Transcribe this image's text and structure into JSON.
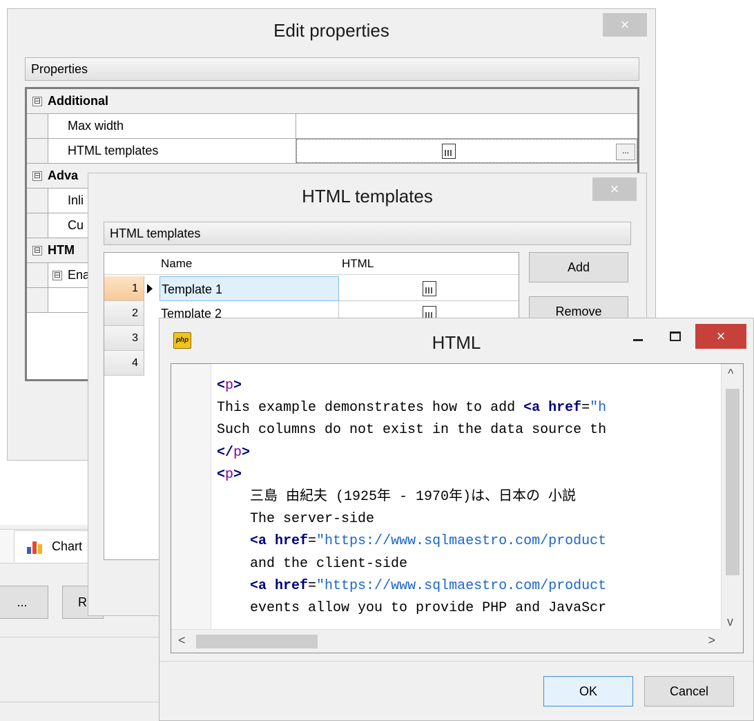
{
  "background": {
    "tab_label": "Chart",
    "button_left_label": "...",
    "button_right_label": "R"
  },
  "edit_dialog": {
    "title": "Edit properties",
    "close_glyph": "×",
    "group_label": "Properties",
    "categories": [
      {
        "label": "Additional",
        "expander": "⊟"
      },
      {
        "label": "Adva",
        "expander": "⊟"
      },
      {
        "label": "HTM",
        "expander": "⊟"
      }
    ],
    "properties": [
      {
        "name": "Max width",
        "value": ""
      },
      {
        "name": "HTML templates",
        "value": "",
        "ellipsis": "..."
      },
      {
        "name": "Inli"
      },
      {
        "name": "Cu"
      },
      {
        "name": "Ena",
        "expander": "⊟"
      }
    ]
  },
  "templates_dialog": {
    "title": "HTML templates",
    "close_glyph": "×",
    "group_label": "HTML templates",
    "columns": [
      "Name",
      "HTML"
    ],
    "rows": [
      {
        "num": "1",
        "name": "Template 1"
      },
      {
        "num": "2",
        "name": "Template 2"
      },
      {
        "num": "3",
        "name": ""
      },
      {
        "num": "4",
        "name": ""
      }
    ],
    "add_label": "Add",
    "remove_label": "Remove"
  },
  "html_window": {
    "icon_text": "php",
    "title": "HTML",
    "minimize_glyph": "–",
    "close_glyph": "×",
    "code_lines": [
      {
        "indent": "",
        "segments": [
          {
            "t": "<",
            "c": "tag"
          },
          {
            "t": "p",
            "c": "tname"
          },
          {
            "t": ">",
            "c": "tag"
          }
        ]
      },
      {
        "indent": "",
        "segments": [
          {
            "t": "This example demonstrates how to add ",
            "c": ""
          },
          {
            "t": "<a href",
            "c": "tag"
          },
          {
            "t": "=",
            "c": ""
          },
          {
            "t": "\"h",
            "c": "str"
          }
        ]
      },
      {
        "indent": "",
        "segments": [
          {
            "t": "Such columns do not exist in the data source th",
            "c": ""
          }
        ]
      },
      {
        "indent": "",
        "segments": [
          {
            "t": "</",
            "c": "tag"
          },
          {
            "t": "p",
            "c": "tname"
          },
          {
            "t": ">",
            "c": "tag"
          }
        ]
      },
      {
        "indent": "",
        "segments": [
          {
            "t": "<",
            "c": "tag"
          },
          {
            "t": "p",
            "c": "tname"
          },
          {
            "t": ">",
            "c": "tag"
          }
        ]
      },
      {
        "indent": "    ",
        "segments": [
          {
            "t": "三島 由紀夫 (1925年 - 1970年)は、日本の 小説",
            "c": ""
          }
        ]
      },
      {
        "indent": "    ",
        "segments": [
          {
            "t": "The server-side",
            "c": ""
          }
        ]
      },
      {
        "indent": "    ",
        "segments": [
          {
            "t": "<a href",
            "c": "tag"
          },
          {
            "t": "=",
            "c": ""
          },
          {
            "t": "\"https://www.sqlmaestro.com/product",
            "c": "str"
          }
        ]
      },
      {
        "indent": "    ",
        "segments": [
          {
            "t": "and the client-side",
            "c": ""
          }
        ]
      },
      {
        "indent": "    ",
        "segments": [
          {
            "t": "<a href",
            "c": "tag"
          },
          {
            "t": "=",
            "c": ""
          },
          {
            "t": "\"https://www.sqlmaestro.com/product",
            "c": "str"
          }
        ]
      },
      {
        "indent": "    ",
        "segments": [
          {
            "t": "events allow you to provide PHP and JavaScr",
            "c": ""
          }
        ]
      }
    ],
    "ok_label": "OK",
    "cancel_label": "Cancel"
  }
}
